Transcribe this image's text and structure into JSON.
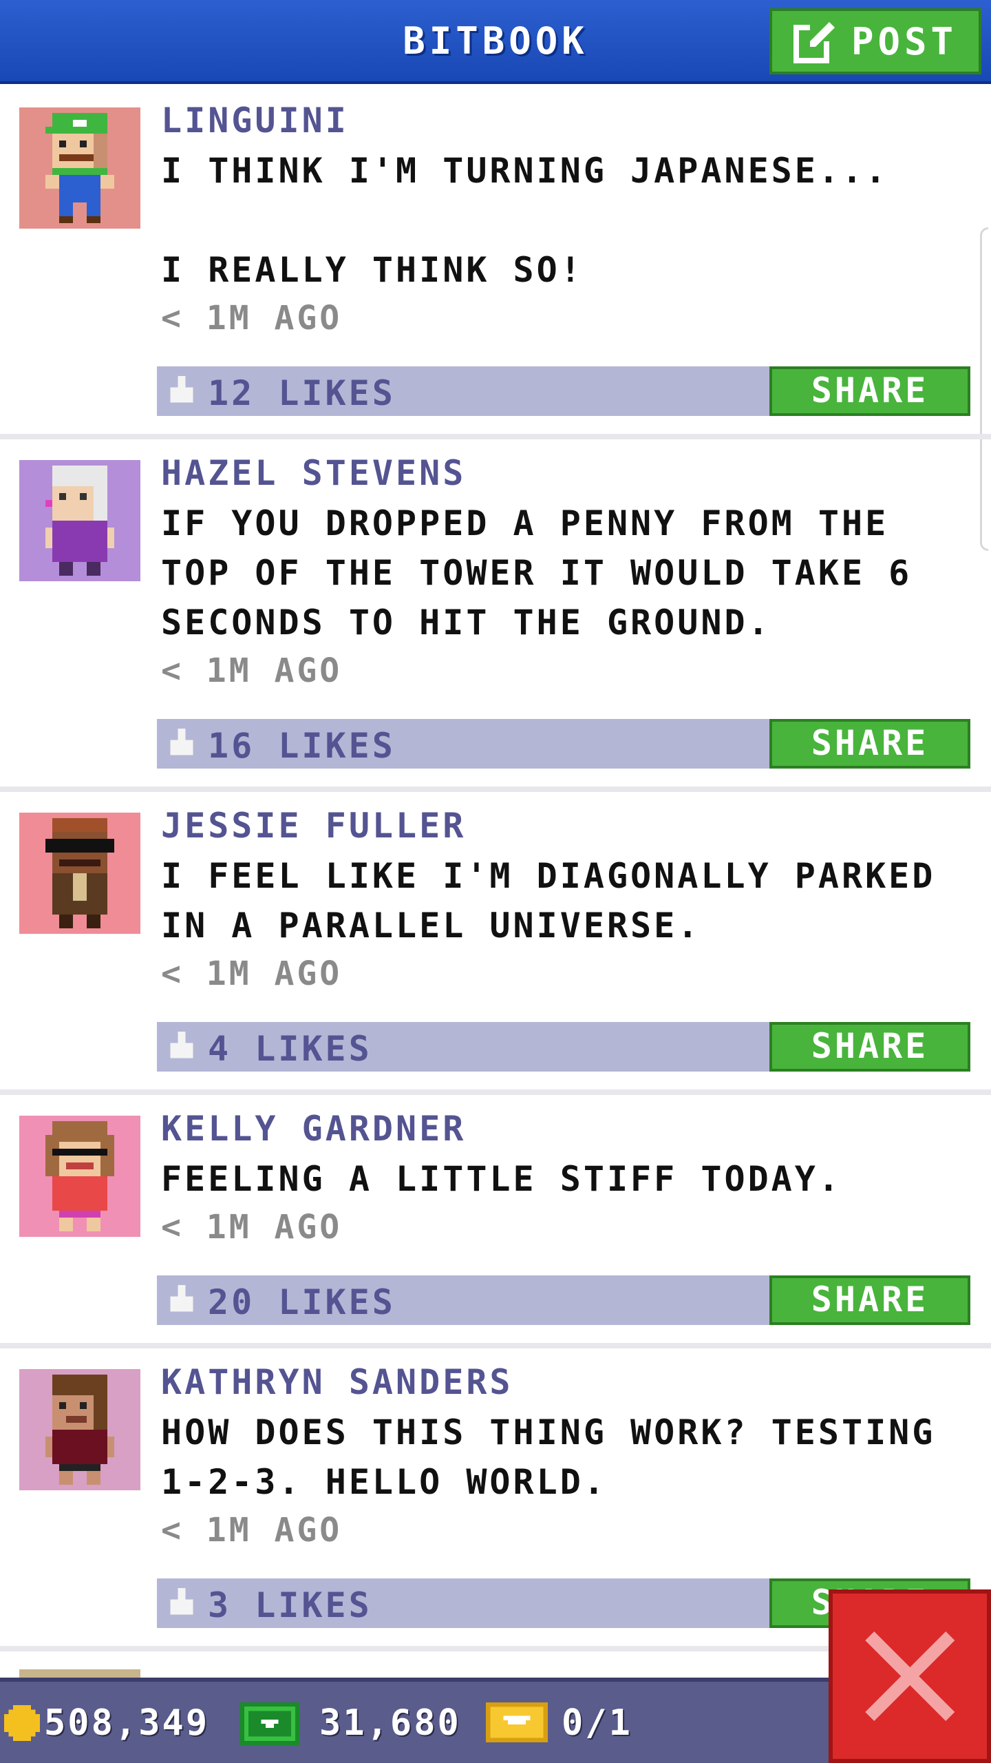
{
  "header": {
    "title": "BITBOOK",
    "post_label": "POST"
  },
  "posts": [
    {
      "author": "LINGUINI",
      "text": "I THINK I'M TURNING JAPANESE...\n\nI REALLY THINK SO!",
      "time": "< 1M AGO",
      "likes": "12 LIKES",
      "share": "SHARE"
    },
    {
      "author": "HAZEL STEVENS",
      "text": "IF YOU DROPPED A PENNY FROM THE TOP OF THE TOWER IT WOULD TAKE 6 SECONDS TO HIT THE GROUND.",
      "time": "< 1M AGO",
      "likes": "16 LIKES",
      "share": "SHARE"
    },
    {
      "author": "JESSIE FULLER",
      "text": "I FEEL LIKE I'M DIAGONALLY PARKED IN A PARALLEL UNIVERSE.",
      "time": "< 1M AGO",
      "likes": "4 LIKES",
      "share": "SHARE"
    },
    {
      "author": "KELLY GARDNER",
      "text": "FEELING A LITTLE STIFF TODAY.",
      "time": "< 1M AGO",
      "likes": "20 LIKES",
      "share": "SHARE"
    },
    {
      "author": "KATHRYN SANDERS",
      "text": "HOW DOES THIS THING WORK? TESTING 1-2-3. HELLO WORLD.",
      "time": "< 1M AGO",
      "likes": "3 LIKES",
      "share": "SHARE"
    }
  ],
  "footer": {
    "coins": "508,349",
    "bux": "31,680",
    "tickets": "0/1"
  },
  "icons": {
    "post": "edit-icon",
    "like": "thumbs-up-icon",
    "close": "close-icon",
    "coins": "coin-icon",
    "bux": "bux-icon",
    "tickets": "ticket-icon"
  },
  "colors": {
    "header": "#1848b4",
    "share": "#48b43c",
    "likes_bar": "#b4b6d6",
    "author": "#545492",
    "close": "#dc2a2a",
    "footer": "#5a5c8c"
  }
}
